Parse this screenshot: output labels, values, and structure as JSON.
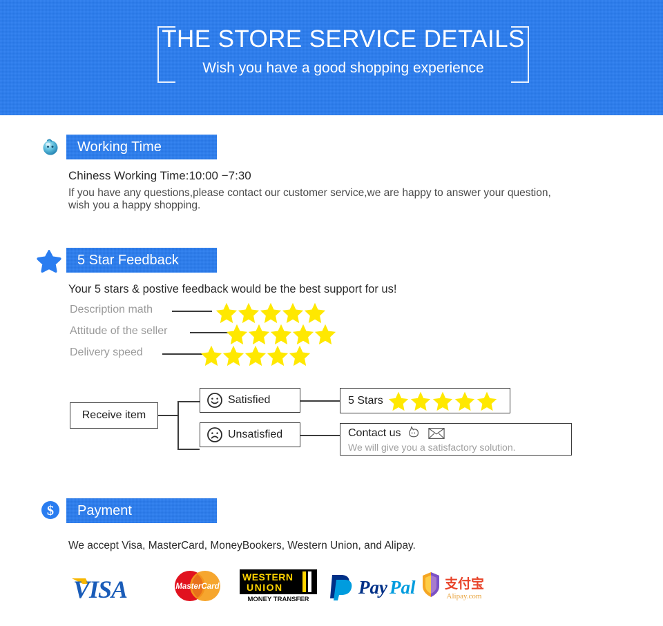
{
  "header": {
    "title": "THE STORE SERVICE DETAILS",
    "subtitle": "Wish you have a good shopping experience",
    "bg_color": "#2a7df0"
  },
  "sections": [
    {
      "id": "working-time",
      "icon": "blue-sphere-icon",
      "label": "Working Time",
      "lines": [
        "Chiness Working Time:10:00 −7:30",
        "If you have any questions,please contact our customer service,we are happy to answer your question,",
        "wish you a happy shopping."
      ]
    },
    {
      "id": "five-star-feedback",
      "icon": "blue-star-icon",
      "label": "5 Star Feedback",
      "intro": "Your 5 stars & postive feedback would be the best support for us!",
      "ratings": [
        {
          "label": "Description math",
          "stars": 5
        },
        {
          "label": "Attitude of the seller",
          "stars": 5
        },
        {
          "label": "Delivery speed",
          "stars": 5
        }
      ],
      "flow": {
        "start": "Receive item",
        "branches": [
          {
            "face": "smiley-face-icon",
            "label": "Satisfied",
            "result_label": "5 Stars",
            "result_stars": 5
          },
          {
            "face": "frowny-face-icon",
            "label": "Unsatisfied",
            "result_label": "Contact us",
            "result_sub": "We will give you a satisfactory solution."
          }
        ]
      }
    },
    {
      "id": "payment",
      "icon": "dollar-circle-icon",
      "label": "Payment",
      "note": "We accept Visa, MasterCard, MoneyBookers, Western Union, and Alipay.",
      "logos": [
        {
          "name": "visa-logo",
          "text": "VISA"
        },
        {
          "name": "mastercard-logo",
          "text": "MasterCard"
        },
        {
          "name": "western-union-logo",
          "text": "WESTERN UNION",
          "sub": "MONEY TRANSFER"
        },
        {
          "name": "paypal-logo",
          "text": "PayPal"
        },
        {
          "name": "alipay-logo",
          "text": "支付宝",
          "sub": "Alipay.com"
        }
      ]
    }
  ],
  "colors": {
    "brand_blue": "#2a7df0",
    "star_yellow": "#ffe800",
    "text_dark": "#2b2b2b",
    "text_grey": "#9a9a9a"
  }
}
